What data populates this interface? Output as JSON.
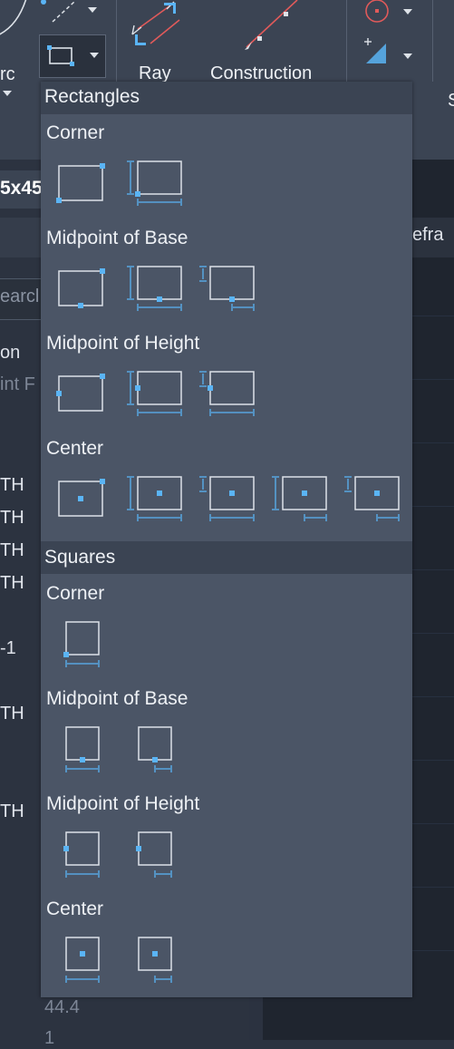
{
  "ribbon": {
    "arc_label": "rc",
    "ray_label": "Ray",
    "construction_label": "Construction",
    "right_label": "S"
  },
  "left_panel": {
    "title": "5x45",
    "search_placeholder": "earcl",
    "rows": [
      "on",
      "int F",
      "TH",
      "TH",
      "TH",
      "TH",
      "-1",
      "TH",
      "TH"
    ],
    "bottom_values": [
      "44.4",
      "1"
    ]
  },
  "right_panel": {
    "header_text": "efra"
  },
  "menu": {
    "rectangles_label": "Rectangles",
    "squares_label": "Squares",
    "rect_groups": [
      {
        "label": "Corner"
      },
      {
        "label": "Midpoint of Base"
      },
      {
        "label": "Midpoint of Height"
      },
      {
        "label": "Center"
      }
    ],
    "square_groups": [
      {
        "label": "Corner"
      },
      {
        "label": "Midpoint of Base"
      },
      {
        "label": "Midpoint of Height"
      },
      {
        "label": "Center"
      }
    ]
  },
  "colors": {
    "accent": "#5ab4f5",
    "menu_bg": "#4b5566",
    "category_bg": "#3b4453"
  }
}
